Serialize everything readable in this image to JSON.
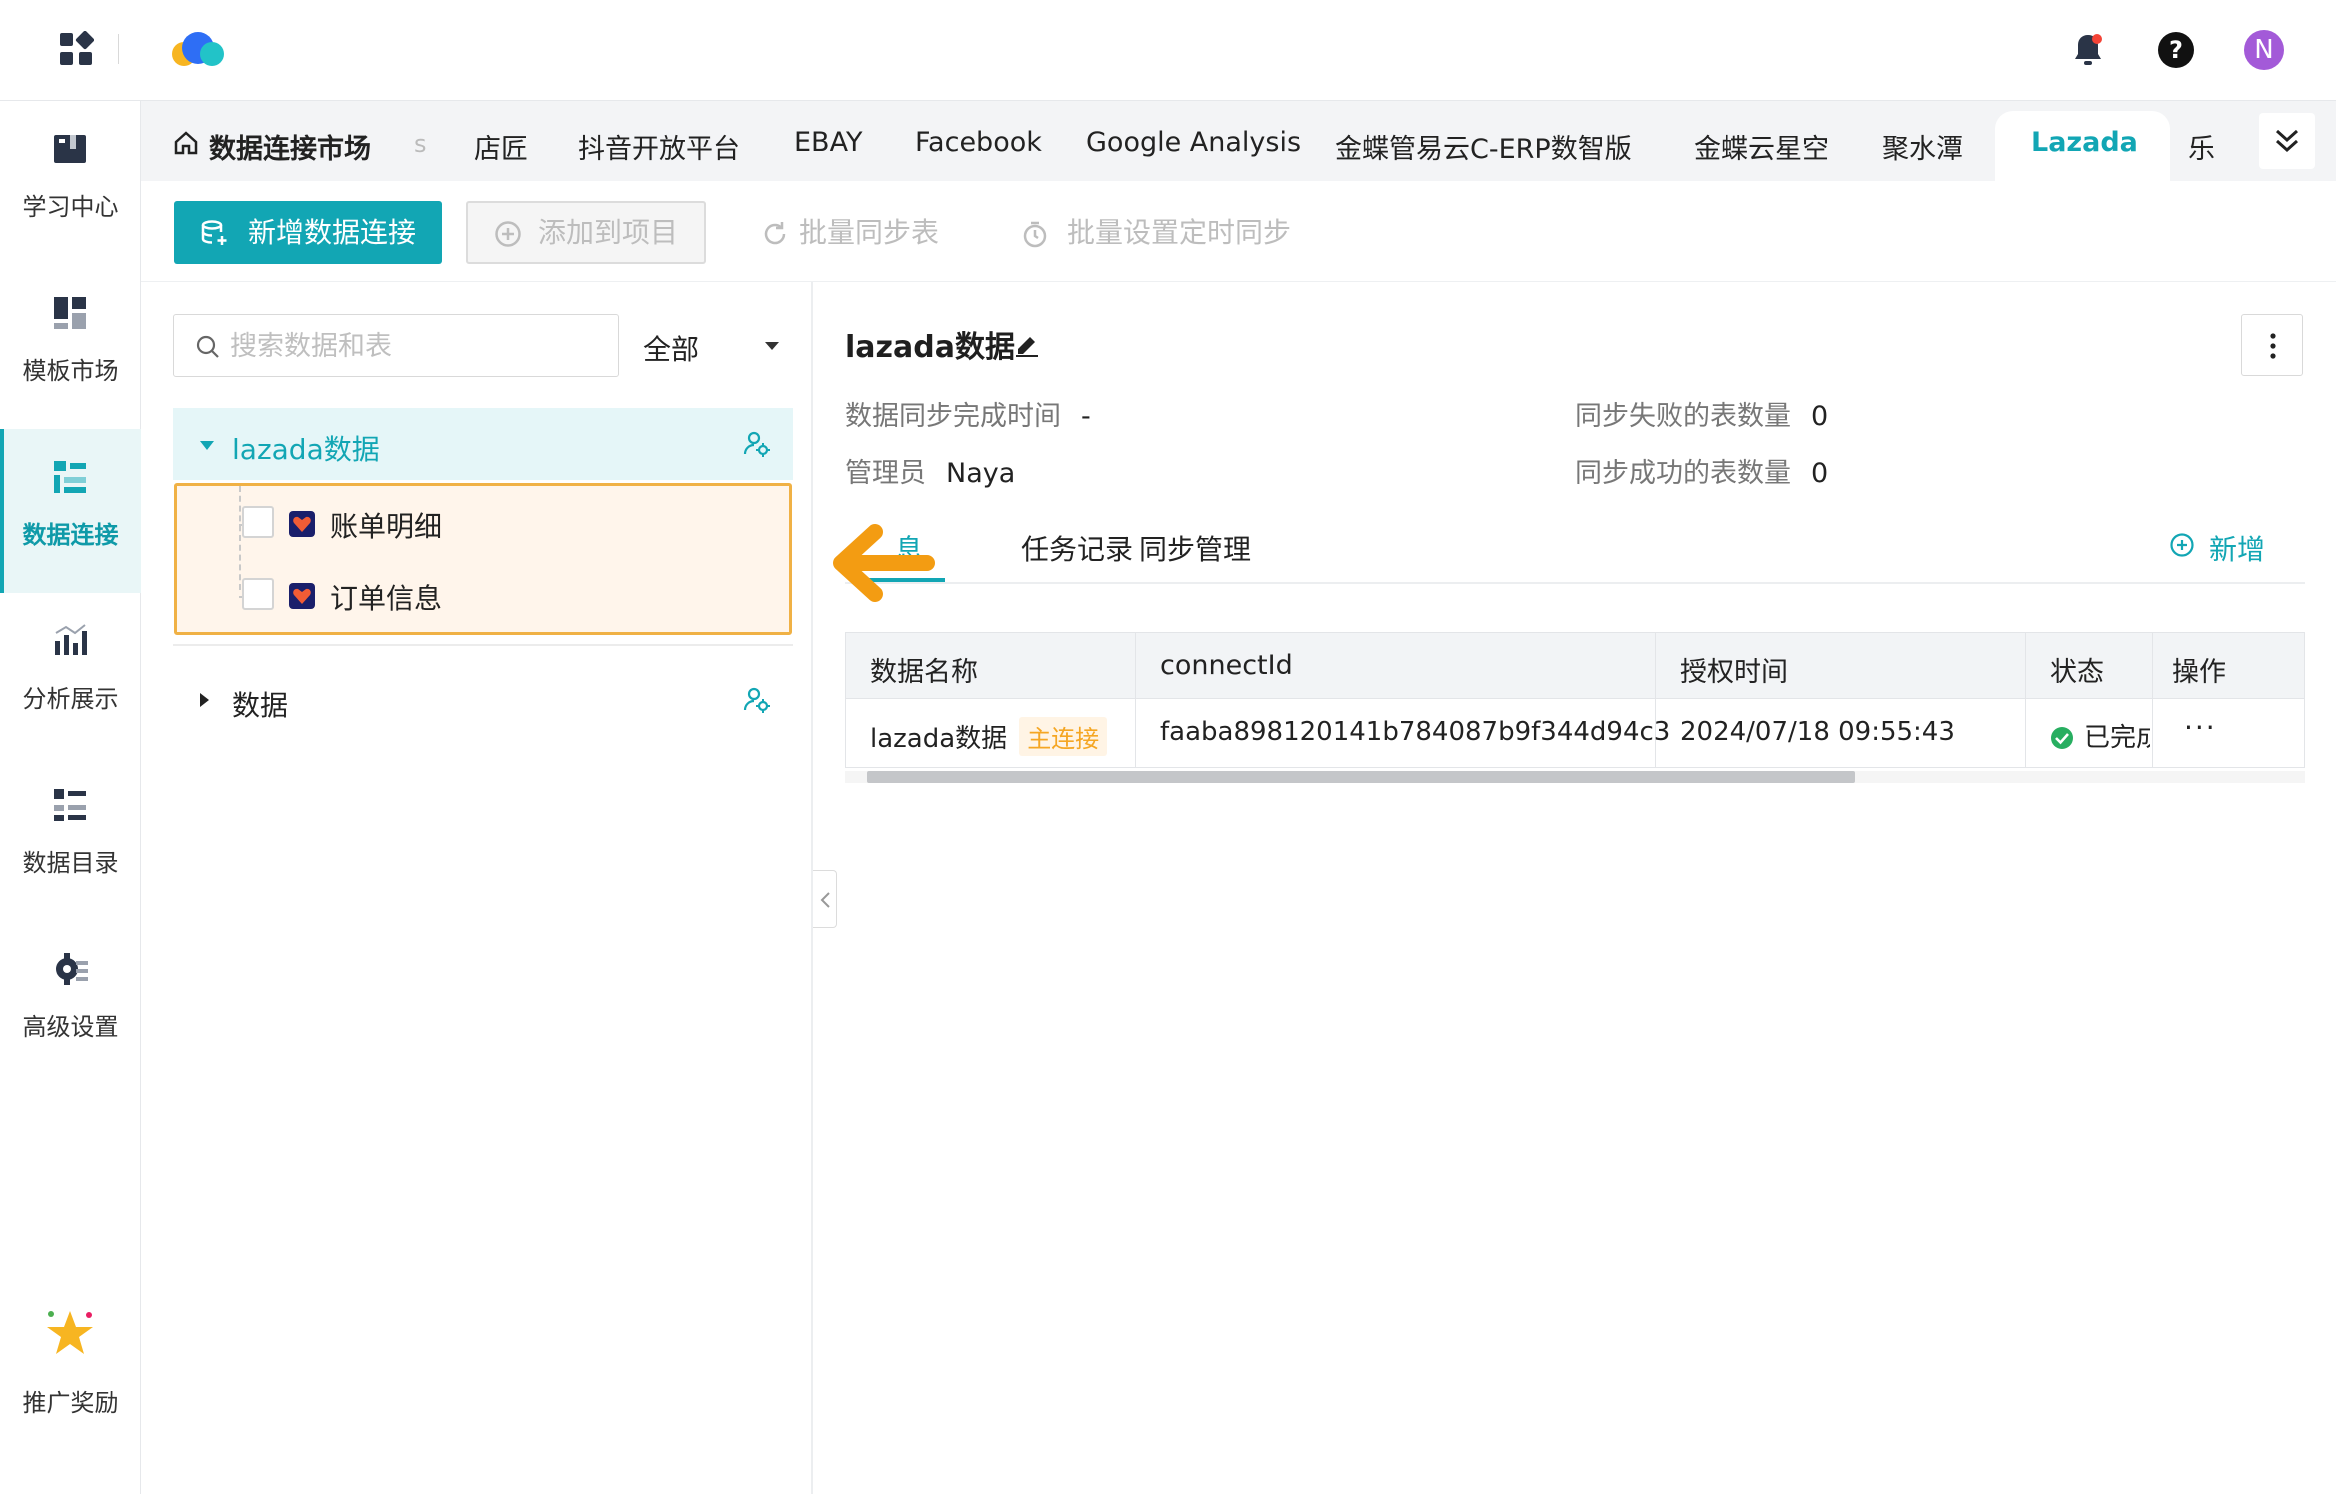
{
  "topbar": {
    "avatar_initial": "N",
    "apps_icon": "grid-apps-icon",
    "logo_icon": "cloud-logo-icon",
    "notification_icon": "bell-icon",
    "help_icon": "question-icon"
  },
  "sidebar": {
    "items": [
      {
        "label": "学习中心",
        "icon": "book-icon",
        "active": false
      },
      {
        "label": "模板市场",
        "icon": "template-icon",
        "active": false
      },
      {
        "label": "数据连接",
        "icon": "data-connection-icon",
        "active": true
      },
      {
        "label": "分析展示",
        "icon": "chart-icon",
        "active": false
      },
      {
        "label": "数据目录",
        "icon": "list-icon",
        "active": false
      },
      {
        "label": "高级设置",
        "icon": "gear-icon",
        "active": false
      }
    ],
    "promo": {
      "label": "推广奖励",
      "icon": "star-icon"
    }
  },
  "tabs": {
    "home_label": "数据连接市场",
    "faded_label": "s",
    "items": [
      "店匠",
      "抖音开放平台",
      "EBAY",
      "Facebook",
      "Google Analysis",
      "金蝶管易云C-ERP数智版",
      "金蝶云星空",
      "聚水潭",
      "Lazada",
      "乐"
    ],
    "active": "Lazada"
  },
  "toolbar": {
    "add_connection": "新增数据连接",
    "add_to_project": "添加到项目",
    "batch_sync": "批量同步表",
    "batch_schedule": "批量设置定时同步"
  },
  "left_panel": {
    "search_placeholder": "搜索数据和表",
    "filter_value": "全部",
    "tree": [
      {
        "label": "lazada数据",
        "expanded": true,
        "children": [
          "账单明细",
          "订单信息"
        ]
      },
      {
        "label": "数据",
        "expanded": false,
        "children": []
      }
    ]
  },
  "detail": {
    "title": "lazada数据",
    "sync_time_label": "数据同步完成时间",
    "sync_time_value": "-",
    "admin_label": "管理员",
    "admin_value": "Naya",
    "failed_label": "同步失败的表数量",
    "failed_value": "0",
    "success_label": "同步成功的表数量",
    "success_value": "0",
    "subtabs": [
      "连接信息",
      "任务记录",
      "同步管理"
    ],
    "subtabs_visible": [
      "息",
      "任务记录",
      "同步管理"
    ],
    "add_label": "新增",
    "table": {
      "columns": [
        "数据名称",
        "connectId",
        "授权时间",
        "状态",
        "操作"
      ],
      "rows": [
        {
          "name": "lazada数据",
          "tag": "主连接",
          "connect_id": "faaba898120141b784087b9f344d94c3",
          "auth_time": "2024/07/18 09:55:43",
          "status": "已完成",
          "ops": "···"
        }
      ]
    }
  },
  "colors": {
    "accent": "#12a6b4",
    "highlight_border": "#f0b145",
    "arrow": "#f39c12",
    "tag": "#f5a623"
  }
}
